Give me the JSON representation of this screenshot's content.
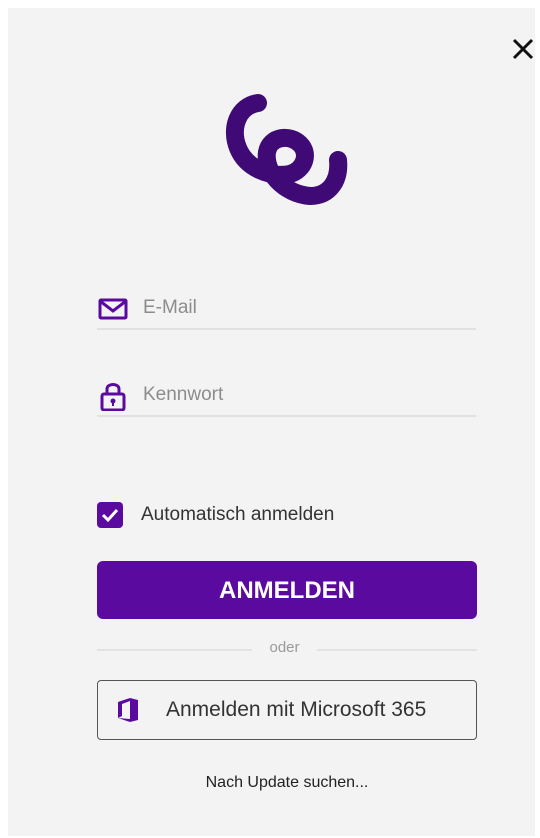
{
  "icons": {
    "close": "close-icon",
    "logo": "app-logo",
    "email": "envelope-icon",
    "password": "lock-icon",
    "checkbox": "checkmark-icon",
    "microsoft": "office-icon"
  },
  "colors": {
    "accent": "#5b0aa0",
    "background": "#f4f3f4",
    "text": "#333333",
    "divider": "#e1e0e2"
  },
  "login": {
    "email_placeholder": "E-Mail",
    "email_value": "",
    "password_placeholder": "Kennwort",
    "password_value": "",
    "auto_login_label": "Automatisch anmelden",
    "auto_login_checked": true,
    "submit_label": "ANMELDEN",
    "divider_text": "oder",
    "microsoft_label": "Anmelden mit Microsoft 365",
    "update_link": "Nach Update suchen..."
  }
}
